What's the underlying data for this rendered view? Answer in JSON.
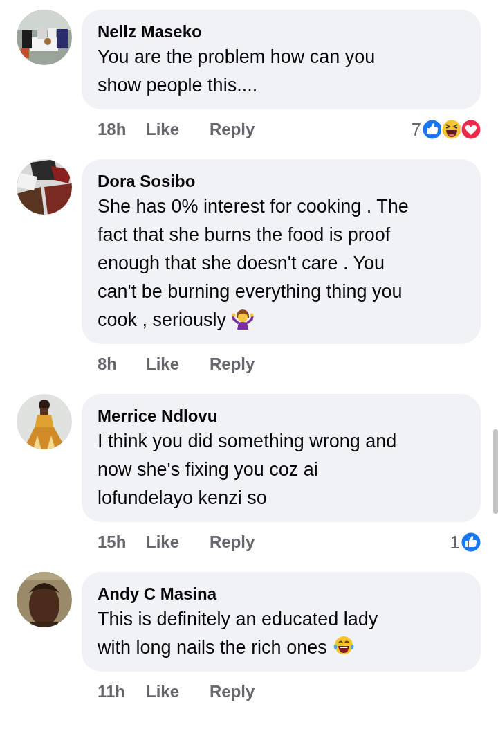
{
  "comments": [
    {
      "author": "Nellz Maseko",
      "avatar": {
        "kind": "picture"
      },
      "text": "You are the problem how can you\nshow people this....",
      "time": "18h",
      "actions": [
        "Like",
        "Reply"
      ],
      "reaction_count": "7",
      "reactions": [
        {
          "kind": "like"
        },
        {
          "kind": "haha"
        },
        {
          "kind": "love"
        }
      ]
    },
    {
      "author": "Dora Sosibo",
      "avatar": {
        "kind": "picture"
      },
      "text": "She has 0% interest for cooking . The\nfact that she burns the food is proof\nenough that she doesn't care . You\ncan't be burning everything thing you\ncook , seriously",
      "emoji": {
        "kind": "shrug"
      },
      "time": "8h",
      "actions": [
        "Like",
        "Reply"
      ]
    },
    {
      "author": "Merrice Ndlovu",
      "avatar": {
        "kind": "picture"
      },
      "text": "I think you did something wrong and\nnow she's fixing you coz ai\nlofundelayo kenzi so",
      "time": "15h",
      "actions": [
        "Like",
        "Reply"
      ],
      "reaction_count": "1",
      "reactions": [
        {
          "kind": "like"
        }
      ]
    },
    {
      "author": "Andy C Masina",
      "avatar": {
        "kind": "picture"
      },
      "text": "This is definitely an educated lady\nwith long nails the rich ones",
      "emoji": {
        "kind": "laugh-cry"
      },
      "time": "11h",
      "actions": [
        "Like",
        "Reply"
      ]
    }
  ]
}
